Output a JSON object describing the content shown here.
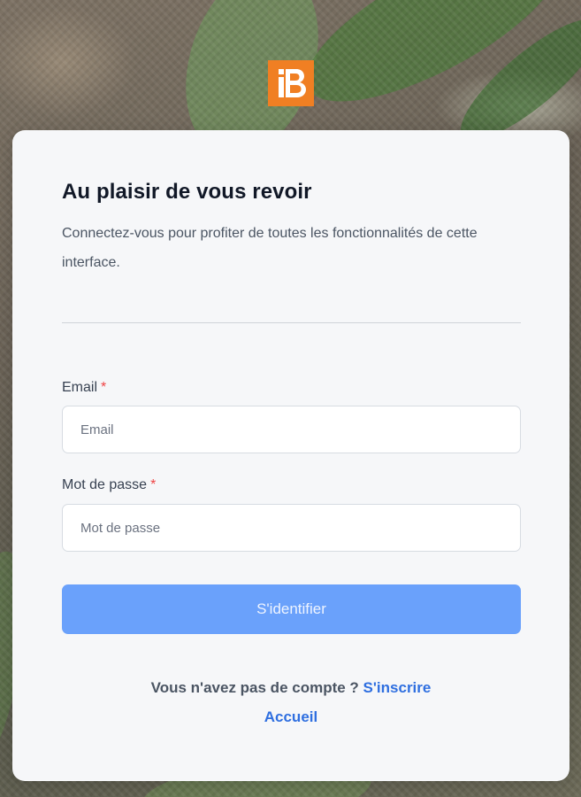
{
  "logo": {
    "text": "iB",
    "color": "#f07f23"
  },
  "login": {
    "title": "Au plaisir de vous revoir",
    "subtitle": "Connectez-vous pour profiter de toutes les fonctionnalités de cette interface.",
    "email": {
      "label": "Email",
      "required_mark": "*",
      "placeholder": "Email",
      "value": ""
    },
    "password": {
      "label": "Mot de passe",
      "required_mark": "*",
      "placeholder": "Mot de passe",
      "value": ""
    },
    "submit_label": "S'identifier",
    "signup_prompt": "Vous n'avez pas de compte ?",
    "signup_link": "S'inscrire",
    "home_link": "Accueil"
  },
  "colors": {
    "accent": "#6aa1fb",
    "link": "#2f6fe0",
    "required": "#ef4444",
    "card_bg": "#f6f7f9"
  }
}
